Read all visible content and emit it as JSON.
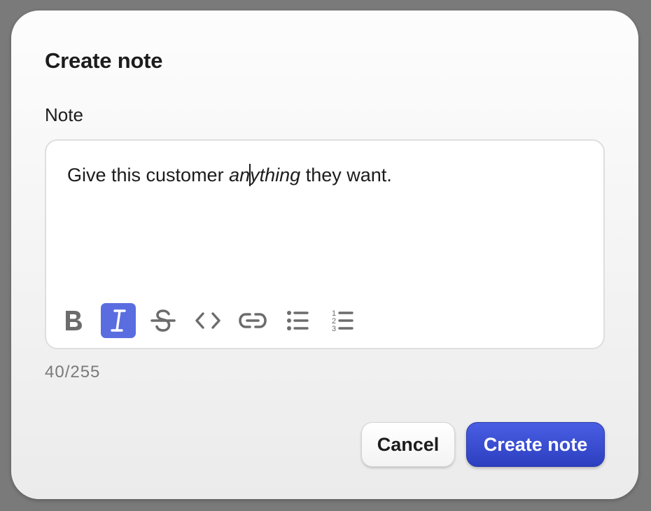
{
  "dialog": {
    "title": "Create note",
    "field_label": "Note",
    "editor": {
      "text_before": "Give this customer ",
      "italic_before_caret": "an",
      "italic_after_caret": "ything",
      "text_after": " they want."
    },
    "toolbar": {
      "items": [
        {
          "name": "bold",
          "icon": "bold-icon",
          "active": false
        },
        {
          "name": "italic",
          "icon": "italic-icon",
          "active": true
        },
        {
          "name": "strikethrough",
          "icon": "strikethrough-icon",
          "active": false
        },
        {
          "name": "code",
          "icon": "code-icon",
          "active": false
        },
        {
          "name": "link",
          "icon": "link-icon",
          "active": false
        },
        {
          "name": "bullet-list",
          "icon": "bullet-list-icon",
          "active": false
        },
        {
          "name": "numbered-list",
          "icon": "numbered-list-icon",
          "active": false
        }
      ],
      "active_color": "#5a6de0"
    },
    "counter": "40/255",
    "cancel_label": "Cancel",
    "submit_label": "Create note",
    "submit_color": "#3a4ed4"
  }
}
